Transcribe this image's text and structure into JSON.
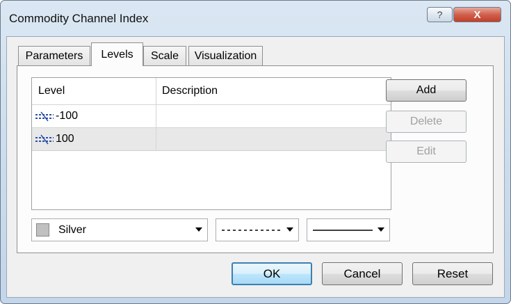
{
  "window": {
    "title": "Commodity Channel Index",
    "help_glyph": "?",
    "close_glyph": "X"
  },
  "tabs": [
    {
      "label": "Parameters",
      "active": false
    },
    {
      "label": "Levels",
      "active": true
    },
    {
      "label": "Scale",
      "active": false
    },
    {
      "label": "Visualization",
      "active": false
    }
  ],
  "levels_table": {
    "columns": [
      "Level",
      "Description"
    ],
    "rows": [
      {
        "level": "-100",
        "description": ""
      },
      {
        "level": "100",
        "description": ""
      }
    ],
    "selected_row_index": 1
  },
  "side_buttons": {
    "add": "Add",
    "delete": "Delete",
    "edit": "Edit"
  },
  "style": {
    "color_name": "Silver",
    "color_hex": "#c0c0c0",
    "line_style": "dashed",
    "line_width": "solid"
  },
  "dialog_buttons": {
    "ok": "OK",
    "cancel": "Cancel",
    "reset": "Reset"
  }
}
